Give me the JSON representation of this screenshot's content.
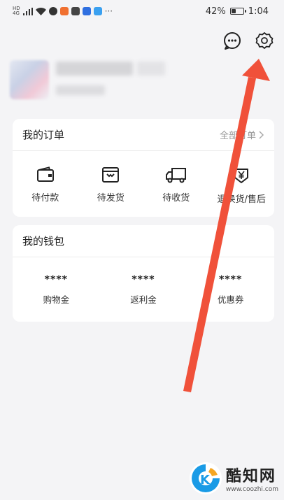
{
  "status_bar": {
    "network_tag_top": "HD",
    "network_tag_mid": "4G",
    "battery_percent": "42%",
    "battery_level": 0.42,
    "time": "1:04",
    "more_dots": "···"
  },
  "header": {
    "icons": [
      "chat-bubble-icon",
      "gear-icon"
    ]
  },
  "orders": {
    "title": "我的订单",
    "all_label": "全部订单",
    "items": [
      {
        "label": "待付款",
        "icon": "wallet-icon"
      },
      {
        "label": "待发货",
        "icon": "package-icon"
      },
      {
        "label": "待收货",
        "icon": "truck-icon"
      },
      {
        "label": "退换货/售后",
        "icon": "refund-icon"
      }
    ]
  },
  "wallet": {
    "title": "我的钱包",
    "items": [
      {
        "value": "****",
        "label": "购物金"
      },
      {
        "value": "****",
        "label": "返利金"
      },
      {
        "value": "****",
        "label": "优惠券"
      }
    ]
  },
  "watermark": {
    "title": "酷知网",
    "url": "www.coozhi.com"
  },
  "colors": {
    "arrow": "#f0513a",
    "background": "#f4f4f6",
    "card": "#ffffff"
  }
}
